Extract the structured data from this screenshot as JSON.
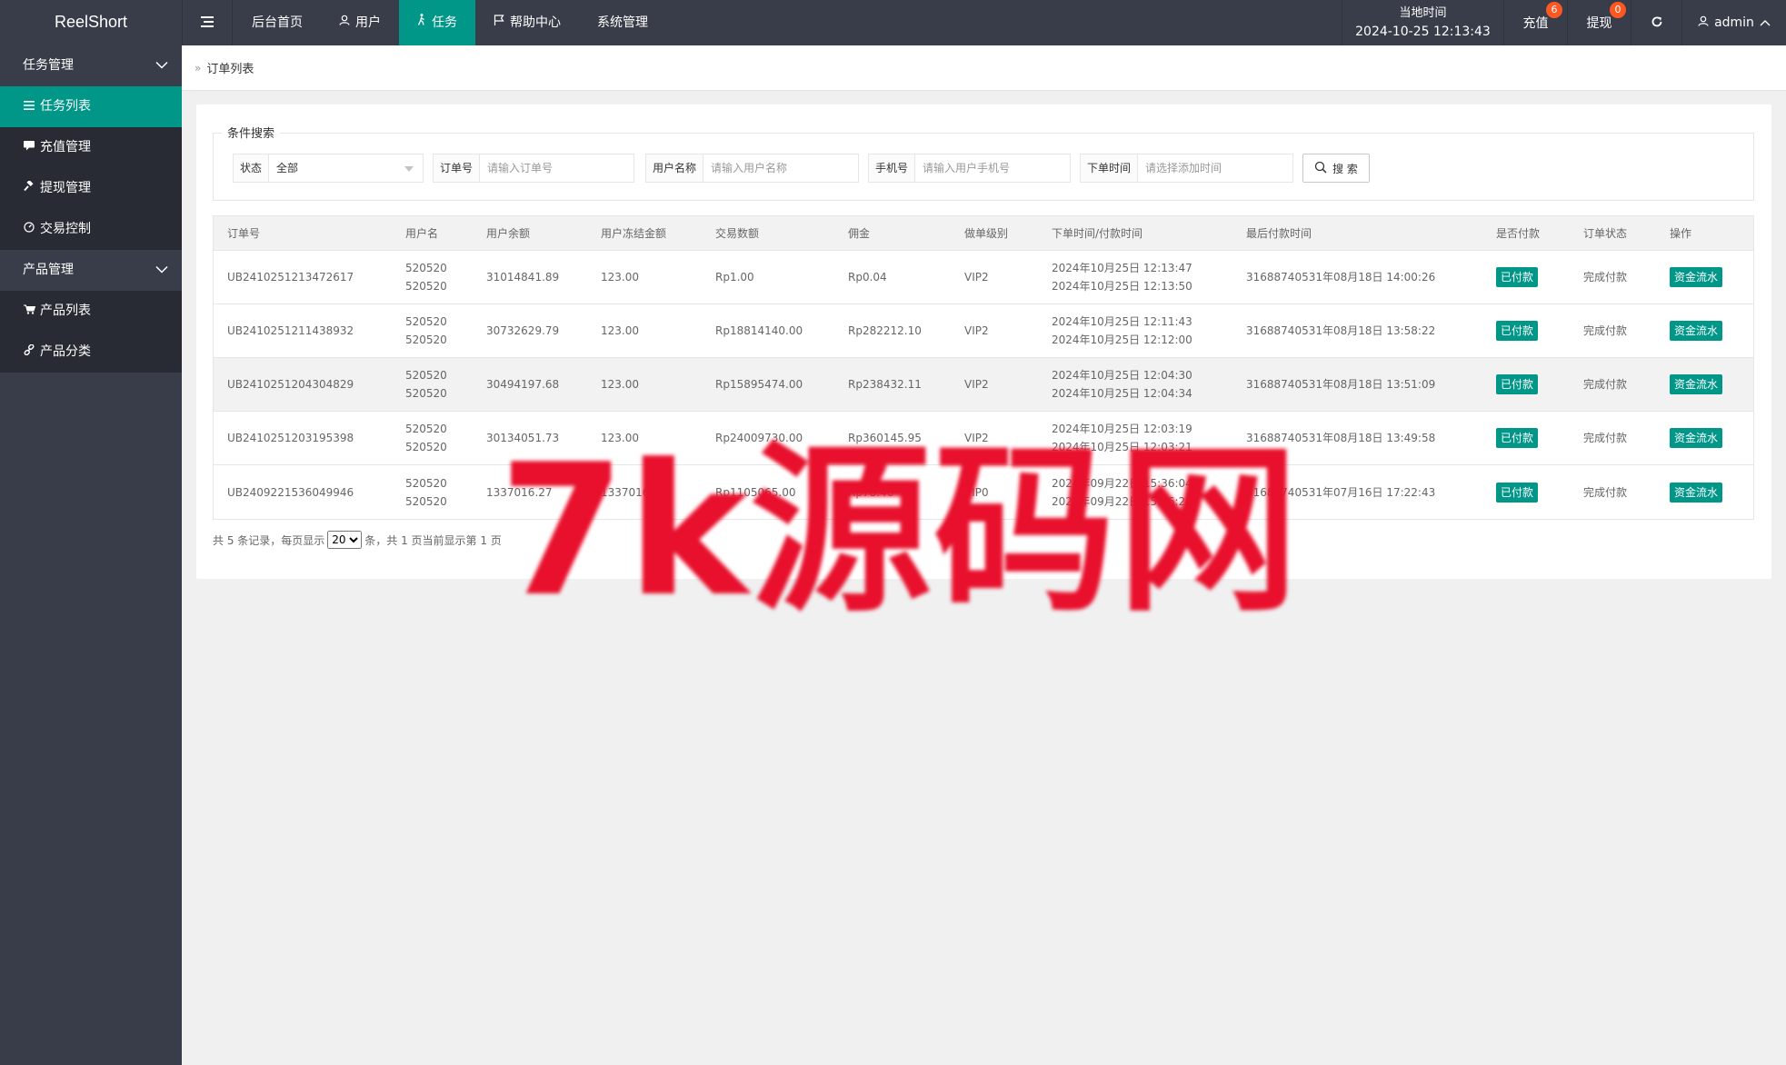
{
  "app": {
    "logo": "ReelShort"
  },
  "topnav": [
    {
      "label": "后台首页",
      "icon": "",
      "active": false
    },
    {
      "label": "用户",
      "icon": "user-icon",
      "active": false
    },
    {
      "label": "任务",
      "icon": "walking-icon",
      "active": true
    },
    {
      "label": "帮助中心",
      "icon": "flag-icon",
      "active": false
    },
    {
      "label": "系统管理",
      "icon": "",
      "active": false
    }
  ],
  "topright": {
    "time_label": "当地时间",
    "time_value": "2024-10-25 12:13:43",
    "recharge_label": "充值",
    "recharge_badge": "6",
    "withdraw_label": "提现",
    "withdraw_badge": "0",
    "admin_label": "admin"
  },
  "sidebar": {
    "group1": "任务管理",
    "items1": [
      "任务列表",
      "充值管理",
      "提现管理",
      "交易控制"
    ],
    "group2": "产品管理",
    "items2": [
      "产品列表",
      "产品分类"
    ]
  },
  "breadcrumb": {
    "current": "订单列表"
  },
  "search": {
    "legend": "条件搜索",
    "status_label": "状态",
    "status_value": "全部",
    "order_label": "订单号",
    "order_placeholder": "请输入订单号",
    "user_label": "用户名称",
    "user_placeholder": "请输入用户名称",
    "phone_label": "手机号",
    "phone_placeholder": "请输入用户手机号",
    "time_label": "下单时间",
    "time_placeholder": "请选择添加时间",
    "button": "搜 索"
  },
  "table": {
    "headers": [
      "订单号",
      "用户名",
      "用户余额",
      "用户冻结金额",
      "交易数额",
      "佣金",
      "做单级别",
      "下单时间/付款时间",
      "最后付款时间",
      "是否付款",
      "订单状态",
      "操作"
    ],
    "rows": [
      {
        "order": "UB2410251213472617",
        "user1": "520520",
        "user2": "520520",
        "balance": "31014841.89",
        "frozen": "123.00",
        "amount": "Rp1.00",
        "commission": "Rp0.04",
        "level": "VIP2",
        "time1": "2024年10月25日 12:13:47",
        "time2": "2024年10月25日 12:13:50",
        "last": "31688740531年08月18日 14:00:26",
        "paid": "已付款",
        "status": "完成付款",
        "action": "资金流水"
      },
      {
        "order": "UB2410251211438932",
        "user1": "520520",
        "user2": "520520",
        "balance": "30732629.79",
        "frozen": "123.00",
        "amount": "Rp18814140.00",
        "commission": "Rp282212.10",
        "level": "VIP2",
        "time1": "2024年10月25日 12:11:43",
        "time2": "2024年10月25日 12:12:00",
        "last": "31688740531年08月18日 13:58:22",
        "paid": "已付款",
        "status": "完成付款",
        "action": "资金流水"
      },
      {
        "order": "UB2410251204304829",
        "user1": "520520",
        "user2": "520520",
        "balance": "30494197.68",
        "frozen": "123.00",
        "amount": "Rp15895474.00",
        "commission": "Rp238432.11",
        "level": "VIP2",
        "time1": "2024年10月25日 12:04:30",
        "time2": "2024年10月25日 12:04:34",
        "last": "31688740531年08月18日 13:51:09",
        "paid": "已付款",
        "status": "完成付款",
        "action": "资金流水"
      },
      {
        "order": "UB2410251203195398",
        "user1": "520520",
        "user2": "520520",
        "balance": "30134051.73",
        "frozen": "123.00",
        "amount": "Rp24009730.00",
        "commission": "Rp360145.95",
        "level": "VIP2",
        "time1": "2024年10月25日 12:03:19",
        "time2": "2024年10月25日 12:03:21",
        "last": "31688740531年08月18日 13:49:58",
        "paid": "已付款",
        "status": "完成付款",
        "action": "资金流水"
      },
      {
        "order": "UB2409221536049946",
        "user1": "520520",
        "user2": "520520",
        "balance": "1337016.27",
        "frozen": "1337016.27",
        "amount": "Rp1105065.00",
        "commission": "Rp78.46",
        "level": "VIP0",
        "time1": "2024年09月22日 15:36:04",
        "time2": "2024年09月22日 15:36:20",
        "last": "31688740531年07月16日 17:22:43",
        "paid": "已付款",
        "status": "完成付款",
        "action": "资金流水"
      }
    ]
  },
  "pager": {
    "prefix": "共 5 条记录，每页显示",
    "page_size": "20",
    "suffix": "条，共 1 页当前显示第 1 页"
  },
  "watermark": "7k源码网",
  "colors": {
    "topbar": "#393d49",
    "accent": "#009688",
    "badge": "#ff5722",
    "sidebar_sub": "#282b33"
  }
}
